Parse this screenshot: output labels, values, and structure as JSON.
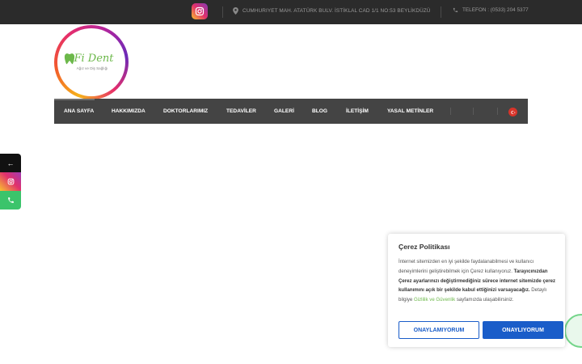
{
  "topbar": {
    "instagram_icon": "instagram-icon",
    "address": "CUMHURIYET MAH. ATATÜRK BULV. İSTİKLAL CAD 1/1 NO:53 BEYLİKDÜZÜ",
    "address_icon": "map-pin-icon",
    "phone": "TELEFON : (0533) 204 5377",
    "phone_icon": "phone-icon"
  },
  "logo": {
    "name": "Fi Dent",
    "tagline": "Ağız ve Diş Sağlığı"
  },
  "nav": {
    "items": [
      {
        "label": "ANA SAYFA"
      },
      {
        "label": "HAKKIMIZDA"
      },
      {
        "label": "DOKTORLARIMIZ"
      },
      {
        "label": "TEDAVİLER"
      },
      {
        "label": "GALERİ"
      },
      {
        "label": "BLOG"
      },
      {
        "label": "İLETİŞİM"
      },
      {
        "label": "YASAL METİNLER"
      }
    ],
    "active_item": "ANA SAYFA",
    "language_icon": "turkey-flag-icon"
  },
  "social_sidebar": {
    "items": [
      {
        "icon": "arrow-left-icon",
        "glyph": "←"
      },
      {
        "icon": "instagram-icon",
        "glyph": ""
      },
      {
        "icon": "phone-icon",
        "glyph": ""
      }
    ]
  },
  "cookie": {
    "title": "Çerez Politikası",
    "text_1": "İnternet sitemizden en iyi şekilde faydalanabilmesi ve kullanıcı deneyimlerini geliştirebilmek için Çerez kullanıyoruz.",
    "text_bold": "Tarayıcınızdan Çerez ayarlarınızı değiştirmediğiniz sürece internet sitemizde çerez kullanımını açık bir şekilde kabul ettiğinizi varsayacağız.",
    "text_2": "Detaylı bilgiye",
    "link": "Gizlilik ve Güvenlik",
    "text_3": "sayfamızda ulaşabilirsiniz.",
    "reject_label": "ONAYLAMIYORUM",
    "accept_label": "ONAYLIYORUM"
  },
  "colors": {
    "topbar_bg": "#2b2b2b",
    "nav_bg": "#444444",
    "accent_green": "#6cb84a",
    "button_blue": "#1a5dc9",
    "whatsapp_green": "#74d58a"
  }
}
